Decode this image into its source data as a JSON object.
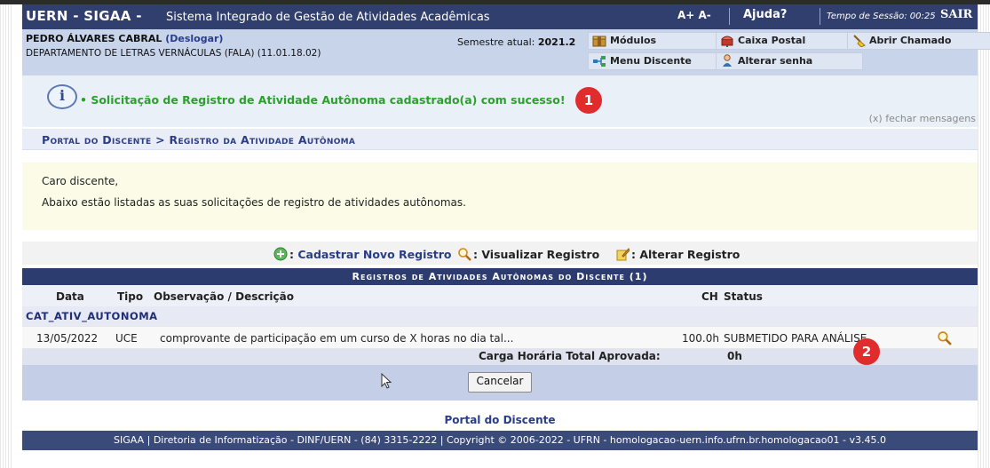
{
  "header": {
    "brand": "UERN - SIGAA -",
    "system_name": "Sistema Integrado de Gestão de Atividades Acadêmicas",
    "font_size_controls": "A+ A-",
    "help": "Ajuda?",
    "session_time": "Tempo de Sessão: 00:25",
    "logout": "SAIR"
  },
  "user": {
    "name": "PEDRO ÁLVARES CABRAL",
    "logout_link": "(Deslogar)",
    "department": "DEPARTAMENTO DE LETRAS VERNÁCULAS (FALA) (11.01.18.02)",
    "semester_label": "Semestre atual:",
    "semester_value": "2021.2"
  },
  "quick_buttons": {
    "modulos": "Módulos",
    "caixa_postal": "Caixa Postal",
    "abrir_chamado": "Abrir Chamado",
    "menu_discente": "Menu Discente",
    "alterar_senha": "Alterar senha"
  },
  "message": {
    "text": "• Solicitação de Registro de Atividade Autônoma cadastrado(a) com sucesso!",
    "close": "(x) fechar mensagens",
    "badge1": "1",
    "badge2": "2"
  },
  "breadcrumb": "Portal do Discente > Registro da Atividade Autônoma",
  "welcome": {
    "line1": "Caro discente,",
    "line2": "Abaixo estão listadas as suas solicitações de registro de atividades autônomas."
  },
  "legend": {
    "cadastrar": "Cadastrar Novo Registro",
    "visualizar": ": Visualizar Registro",
    "alterar": ": Alterar Registro",
    "colon": ":"
  },
  "table": {
    "caption": "Registros de Atividades Autônomas do Discente (1)",
    "headers": {
      "data": "Data",
      "tipo": "Tipo",
      "obs": "Observação / Descrição",
      "ch": "CH",
      "status": "Status"
    },
    "group": "CAT_ATIV_AUTONOMA",
    "rows": [
      {
        "data": "13/05/2022",
        "tipo": "UCE",
        "obs": "comprovante de participação em um curso de X horas no dia tal...",
        "ch": "100.0h",
        "status": "SUBMETIDO PARA ANÁLISE"
      }
    ],
    "total_label": "Carga Horária Total Aprovada:",
    "total_value": "0h"
  },
  "buttons": {
    "cancel": "Cancelar"
  },
  "footer": {
    "portal_link": "Portal do Discente",
    "text": "SIGAA | Diretoria de Informatização - DINF/UERN - (84) 3315-2222 | Copyright © 2006-2022 - UFRN - homologacao-uern.info.ufrn.br.homologacao01 - v3.45.0"
  },
  "colors": {
    "header_bg": "#313f6e",
    "success": "#2aa22a",
    "badge": "#e02c2c",
    "link": "#2a3d88"
  }
}
